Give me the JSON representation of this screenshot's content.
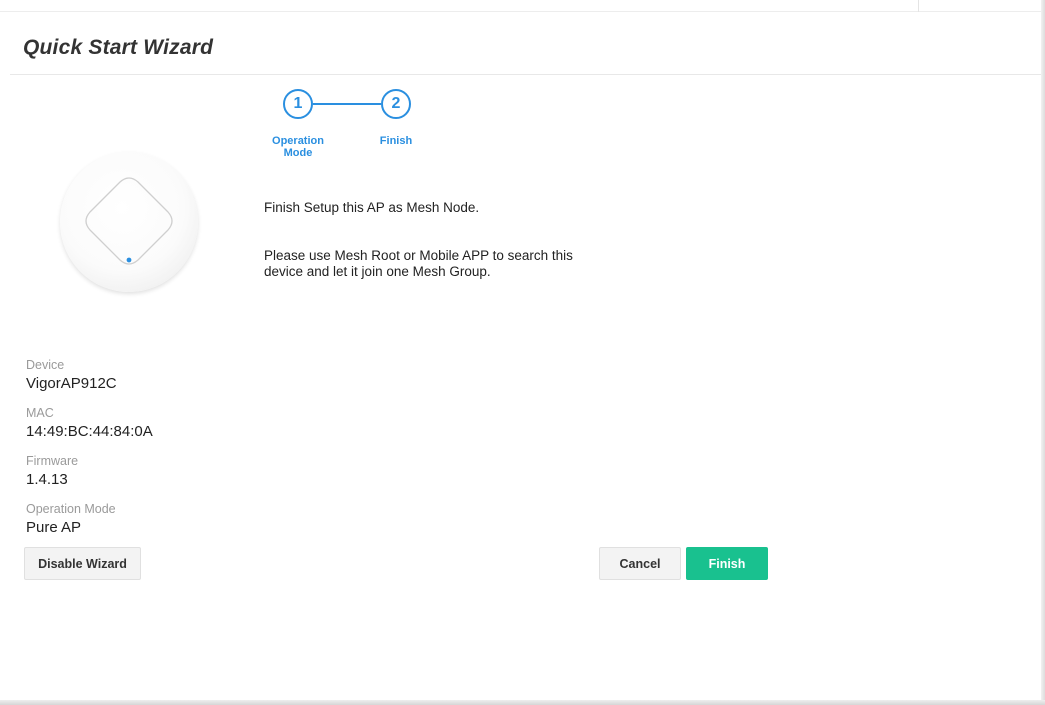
{
  "wizard": {
    "title": "Quick Start Wizard"
  },
  "stepper": {
    "steps": [
      {
        "number": "1",
        "label_line1": "Operation",
        "label_line2": "Mode"
      },
      {
        "number": "2",
        "label_line1": "Finish",
        "label_line2": ""
      }
    ]
  },
  "message": {
    "line1": "Finish Setup this AP as Mesh Node.",
    "line2a": "Please use Mesh Root or Mobile APP to search this",
    "line2b": "device and let it join one Mesh Group."
  },
  "device_info": {
    "device_label": "Device",
    "device_value": "VigorAP912C",
    "mac_label": "MAC",
    "mac_value": "14:49:BC:44:84:0A",
    "firmware_label": "Firmware",
    "firmware_value": "1.4.13",
    "mode_label": "Operation Mode",
    "mode_value": "Pure AP"
  },
  "buttons": {
    "disable_wizard": "Disable Wizard",
    "cancel": "Cancel",
    "finish": "Finish"
  },
  "colors": {
    "accent": "#2a8fe0",
    "primary_button": "#19c18f",
    "muted_label": "#9a9a9a"
  }
}
